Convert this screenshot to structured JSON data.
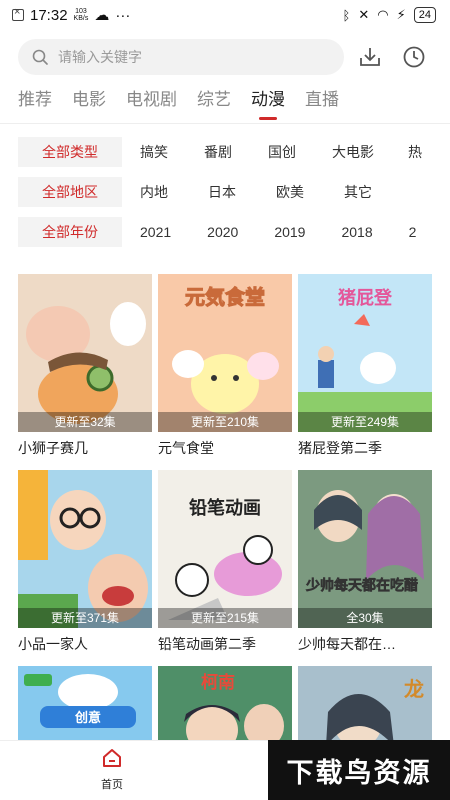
{
  "status": {
    "time": "17:32",
    "speed_value": "103",
    "speed_unit": "KB/s",
    "more": "···",
    "battery": "24"
  },
  "search": {
    "placeholder": "请输入关键字"
  },
  "icons": {
    "download": "download-icon",
    "history": "clock-icon",
    "search": "search-icon"
  },
  "tabs": [
    {
      "label": "推荐"
    },
    {
      "label": "电影"
    },
    {
      "label": "电视剧"
    },
    {
      "label": "综艺"
    },
    {
      "label": "动漫",
      "active": true
    },
    {
      "label": "直播"
    }
  ],
  "filters": {
    "type": {
      "head": "全部类型",
      "options": [
        "搞笑",
        "番剧",
        "国创",
        "大电影",
        "热"
      ]
    },
    "region": {
      "head": "全部地区",
      "options": [
        "内地",
        "日本",
        "欧美",
        "其它"
      ]
    },
    "year": {
      "head": "全部年份",
      "options": [
        "2021",
        "2020",
        "2019",
        "2018",
        "2"
      ]
    }
  },
  "cards": [
    {
      "title": "小狮子赛几",
      "badge": "更新至32集",
      "bg": "#e8d6c4"
    },
    {
      "title": "元气食堂",
      "badge": "更新至210集",
      "bg": "#f7c6a4",
      "poster_text": "元気食堂"
    },
    {
      "title": "猪屁登第二季",
      "badge": "更新至249集",
      "bg": "#bfe3f5",
      "poster_text": "猪屁登"
    },
    {
      "title": "小品一家人",
      "badge": "更新至371集",
      "bg": "#9ccde6"
    },
    {
      "title": "铅笔动画第二季",
      "badge": "更新至215集",
      "bg": "#f0ede6",
      "poster_text": "铅笔动画"
    },
    {
      "title": "少帅每天都在…",
      "badge": "全30集",
      "bg": "#6a8a70",
      "poster_text": "少帅每天都在吃醋"
    },
    {
      "title": "",
      "badge": "",
      "bg": "#7fc3ea",
      "poster_text": "创意"
    },
    {
      "title": "",
      "badge": "",
      "bg": "#4c8a64",
      "poster_text": "柯南"
    },
    {
      "title": "",
      "badge": "",
      "bg": "#9fb8c8",
      "poster_text": "龙"
    }
  ],
  "bottom_nav": {
    "home": "首页"
  },
  "watermark": "下载鸟资源",
  "colors": {
    "accent": "#d02a2a"
  }
}
